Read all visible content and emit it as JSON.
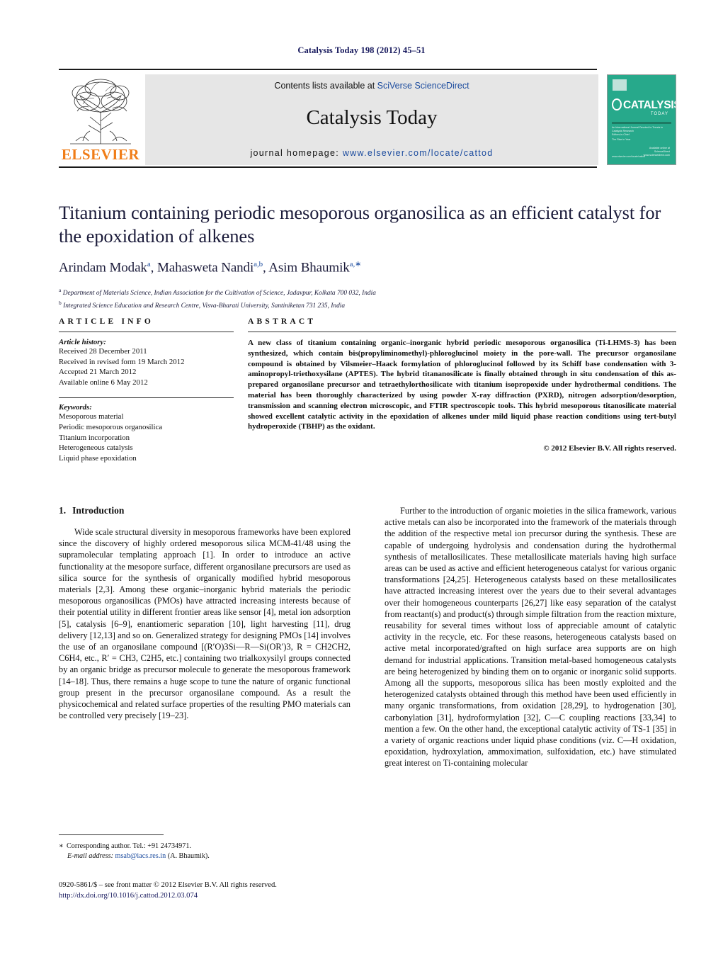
{
  "running_head": "Catalysis Today 198 (2012) 45–51",
  "header": {
    "publisher": "ELSEVIER",
    "contents_prefix": "Contents lists available at ",
    "contents_link": "SciVerse ScienceDirect",
    "journal_name": "Catalysis Today",
    "homepage_prefix": "journal homepage: ",
    "homepage_url": "www.elsevier.com/locate/cattod",
    "cover": {
      "title": "CATALYSIS",
      "subtitle": "TODAY",
      "meta_lines": [
        "An International Journal Devoted to Trends in Catalysis Research",
        "Editors-in-Chief",
        "The Rise in Year"
      ],
      "footer_right": [
        "Available online at",
        "ScienceDirect",
        "www.sciencedirect.com"
      ],
      "footer_left": "www.elsevier.com/locate/cattod"
    }
  },
  "article": {
    "title": "Titanium containing periodic mesoporous organosilica as an efficient catalyst for the epoxidation of alkenes",
    "authors": [
      {
        "name": "Arindam Modak",
        "marks": "a"
      },
      {
        "name": "Mahasweta Nandi",
        "marks": "a,b"
      },
      {
        "name": "Asim Bhaumik",
        "marks": "a,∗"
      }
    ],
    "affiliations": [
      {
        "mark": "a",
        "text": "Department of Materials Science, Indian Association for the Cultivation of Science, Jadavpur, Kolkata 700 032, India"
      },
      {
        "mark": "b",
        "text": "Integrated Science Education and Research Centre, Visva-Bharati University, Santiniketan 731 235, India"
      }
    ]
  },
  "article_info": {
    "heading": "ARTICLE INFO",
    "history_label": "Article history:",
    "history": [
      "Received 28 December 2011",
      "Received in revised form 19 March 2012",
      "Accepted 21 March 2012",
      "Available online 6 May 2012"
    ],
    "keywords_label": "Keywords:",
    "keywords": [
      "Mesoporous material",
      "Periodic mesoporous organosilica",
      "Titanium incorporation",
      "Heterogeneous catalysis",
      "Liquid phase epoxidation"
    ]
  },
  "abstract": {
    "heading": "ABSTRACT",
    "body": "A new class of titanium containing organic–inorganic hybrid periodic mesoporous organosilica (Ti-LHMS-3) has been synthesized, which contain bis(propyliminomethyl)-phloroglucinol moiety in the pore-wall. The precursor organosilane compound is obtained by Vilsmeier–Haack formylation of phloroglucinol followed by its Schiff base condensation with 3-aminopropyl-triethoxysilane (APTES). The hybrid titananosilicate is finally obtained through in situ condensation of this as-prepared organosilane precursor and tetraethylorthosilicate with titanium isopropoxide under hydrothermal conditions. The material has been thoroughly characterized by using powder X-ray diffraction (PXRD), nitrogen adsorption/desorption, transmission and scanning electron microscopic, and FTIR spectroscopic tools. This hybrid mesoporous titanosilicate material showed excellent catalytic activity in the epoxidation of alkenes under mild liquid phase reaction conditions using tert-butyl hydroperoxide (TBHP) as the oxidant.",
    "copyright": "© 2012 Elsevier B.V. All rights reserved."
  },
  "section": {
    "number": "1.",
    "title": "Introduction",
    "left_paragraph": "Wide scale structural diversity in mesoporous frameworks have been explored since the discovery of highly ordered mesoporous silica MCM-41/48 using the supramolecular templating approach [1]. In order to introduce an active functionality at the mesopore surface, different organosilane precursors are used as silica source for the synthesis of organically modified hybrid mesoporous materials [2,3]. Among these organic–inorganic hybrid materials the periodic mesoporous organosilicas (PMOs) have attracted increasing interests because of their potential utility in different frontier areas like sensor [4], metal ion adsorption [5], catalysis [6–9], enantiomeric separation [10], light harvesting [11], drug delivery [12,13] and so on. Generalized strategy for designing PMOs [14] involves the use of an organosilane compound [(R′O)3Si—R—Si(OR′)3, R = CH2CH2, C6H4, etc., R′ = CH3, C2H5, etc.] containing two trialkoxysilyl groups connected by an organic bridge as precursor molecule to generate the mesoporous framework [14–18]. Thus, there remains a huge scope to tune the nature of organic functional group present in the precursor organosilane compound. As a result the physicochemical and related surface properties of the resulting PMO materials can be controlled very precisely [19–23].",
    "right_paragraph": "Further to the introduction of organic moieties in the silica framework, various active metals can also be incorporated into the framework of the materials through the addition of the respective metal ion precursor during the synthesis. These are capable of undergoing hydrolysis and condensation during the hydrothermal synthesis of metallosilicates. These metallosilicate materials having high surface areas can be used as active and efficient heterogeneous catalyst for various organic transformations [24,25]. Heterogeneous catalysts based on these metallosilicates have attracted increasing interest over the years due to their several advantages over their homogeneous counterparts [26,27] like easy separation of the catalyst from reactant(s) and product(s) through simple filtration from the reaction mixture, reusability for several times without loss of appreciable amount of catalytic activity in the recycle, etc. For these reasons, heterogeneous catalysts based on active metal incorporated/grafted on high surface area supports are on high demand for industrial applications. Transition metal-based homogeneous catalysts are being heterogenized by binding them on to organic or inorganic solid supports. Among all the supports, mesoporous silica has been mostly exploited and the heterogenized catalysts obtained through this method have been used efficiently in many organic transformations, from oxidation [28,29], to hydrogenation [30], carbonylation [31], hydroformylation [32], C—C coupling reactions [33,34] to mention a few. On the other hand, the exceptional catalytic activity of TS-1 [35] in a variety of organic reactions under liquid phase conditions (viz. C—H oxidation, epoxidation, hydroxylation, ammoximation, sulfoxidation, etc.) have stimulated great interest on Ti-containing molecular"
  },
  "footnote": {
    "star": "∗",
    "corresponding": "Corresponding author. Tel.: +91 24734971.",
    "email_label": "E-mail address:",
    "email": "msab@iacs.res.in",
    "email_suffix": "(A. Bhaumik)."
  },
  "imprint": {
    "front_matter": "0920-5861/$ – see front matter © 2012 Elsevier B.V. All rights reserved.",
    "doi": "http://dx.doi.org/10.1016/j.cattod.2012.03.074"
  },
  "colors": {
    "navy": "#15175c",
    "link_blue": "#1b4b9e",
    "elsevier_orange": "#f07d18",
    "band_grey": "#e6e6e6",
    "cover_green": "#27a98b"
  }
}
